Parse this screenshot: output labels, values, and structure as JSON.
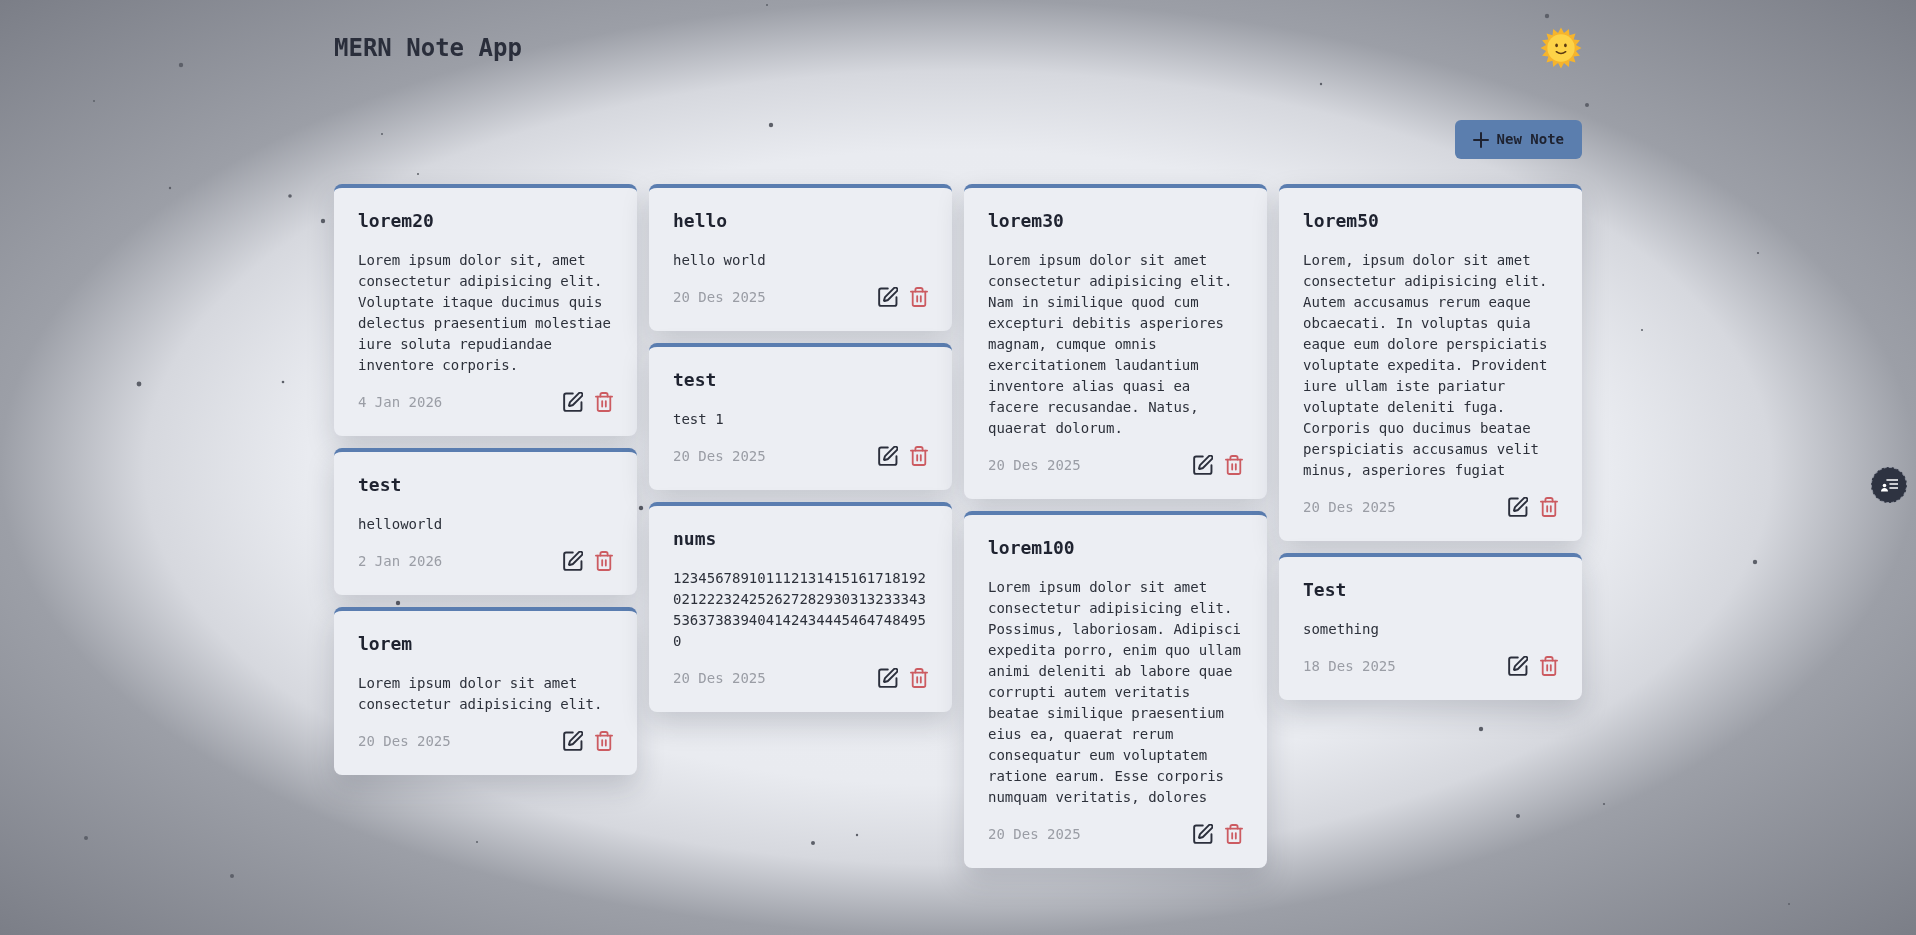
{
  "header": {
    "title": "MERN Note App"
  },
  "new_note_button": {
    "label": "New Note"
  },
  "columns": [
    {
      "notes": [
        {
          "title": "lorem20",
          "body": "Lorem ipsum dolor sit, amet consectetur adipisicing elit. Voluptate itaque ducimus quis delectus praesentium molestiae iure soluta repudiandae inventore corporis.",
          "date": "4 Jan 2026"
        },
        {
          "title": "test",
          "body": "helloworld",
          "date": "2 Jan 2026"
        },
        {
          "title": "lorem",
          "body": "Lorem ipsum dolor sit amet consectetur adipisicing elit.",
          "date": "20 Des 2025"
        }
      ]
    },
    {
      "notes": [
        {
          "title": "hello",
          "body": "hello world",
          "date": "20 Des 2025"
        },
        {
          "title": "test",
          "body": "test 1",
          "date": "20 Des 2025"
        },
        {
          "title": "nums",
          "body": "1234567891011121314151617181920212223242526272829303132333435363738394041424344454647484950",
          "date": "20 Des 2025"
        }
      ]
    },
    {
      "notes": [
        {
          "title": "lorem30",
          "body": "Lorem ipsum dolor sit amet consectetur adipisicing elit. Nam in similique quod cum excepturi debitis asperiores magnam, cumque omnis exercitationem laudantium inventore alias quasi ea facere recusandae. Natus, quaerat dolorum.",
          "date": "20 Des 2025"
        },
        {
          "title": "lorem100",
          "body": "Lorem ipsum dolor sit amet consectetur adipisicing elit. Possimus, laboriosam. Adipisci expedita porro, enim quo ullam animi deleniti ab labore quae corrupti autem veritatis beatae similique praesentium eius ea, quaerat rerum consequatur eum voluptatem ratione earum. Esse corporis numquam veritatis, dolores",
          "date": "20 Des 2025"
        }
      ]
    },
    {
      "notes": [
        {
          "title": "lorem50",
          "body": "Lorem, ipsum dolor sit amet consectetur adipisicing elit. Autem accusamus rerum eaque obcaecati. In voluptas quia eaque eum dolore perspiciatis voluptate expedita. Provident iure ullam iste pariatur voluptate deleniti fuga. Corporis quo ducimus beatae perspiciatis accusamus velit minus, asperiores fugiat",
          "date": "20 Des 2025"
        },
        {
          "title": "Test",
          "body": "something",
          "date": "18 Des 2025"
        }
      ]
    }
  ]
}
